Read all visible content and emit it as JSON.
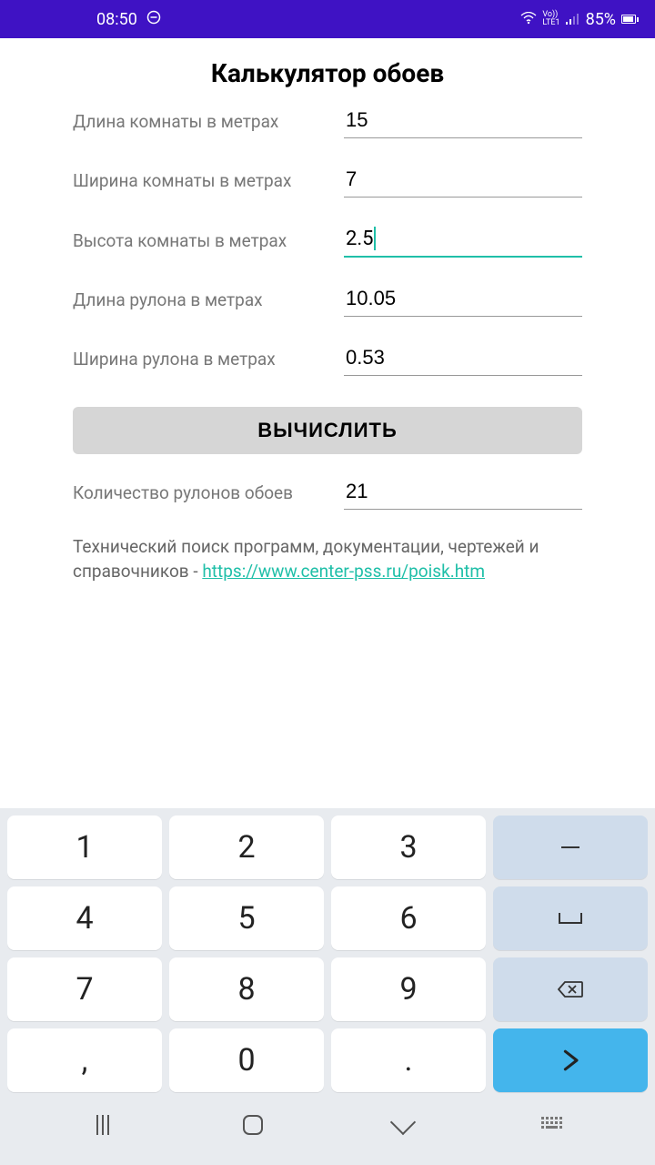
{
  "status": {
    "time": "08:50",
    "battery": "85%",
    "lte": "Vo))\nLTE1"
  },
  "title": "Калькулятор обоев",
  "fields": {
    "room_length": {
      "label": "Длина комнаты в метрах",
      "value": "15"
    },
    "room_width": {
      "label": "Ширина комнаты в метрах",
      "value": "7"
    },
    "room_height": {
      "label": "Высота комнаты в метрах",
      "value": "2.5"
    },
    "roll_length": {
      "label": "Длина рулона в метрах",
      "value": "10.05"
    },
    "roll_width": {
      "label": "Ширина рулона в метрах",
      "value": "0.53"
    },
    "result": {
      "label": "Количество рулонов обоев",
      "value": "21"
    }
  },
  "button": "ВЫЧИСЛИТЬ",
  "footer": {
    "text": "Технический поиск программ, документации, чертежей и справочников - ",
    "link_text": "https://www.center-pss.ru/poisk.htm"
  },
  "keyboard": {
    "rows": [
      [
        "1",
        "2",
        "3"
      ],
      [
        "4",
        "5",
        "6"
      ],
      [
        "7",
        "8",
        "9"
      ],
      [
        ",",
        "0",
        "."
      ]
    ]
  }
}
